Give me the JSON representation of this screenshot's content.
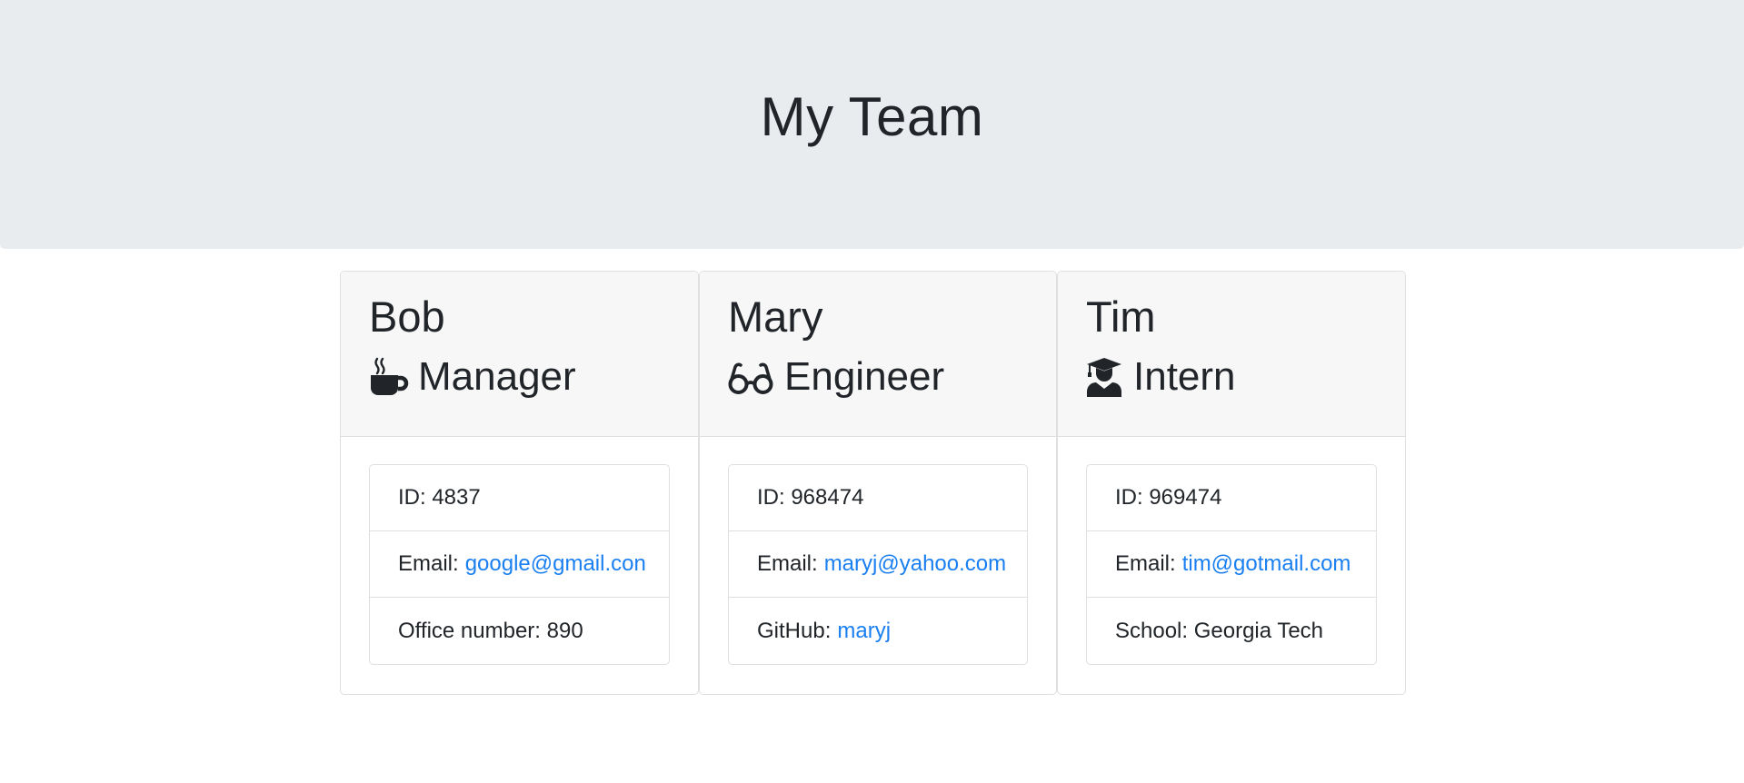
{
  "header": {
    "title": "My Team"
  },
  "team": [
    {
      "name": "Bob",
      "role": "Manager",
      "icon": "coffee-mug-icon",
      "id_label": "ID: 4837",
      "email_prefix": "Email:",
      "email": "google@gmail.con",
      "extra_label": "Office number: 890"
    },
    {
      "name": "Mary",
      "role": "Engineer",
      "icon": "glasses-icon",
      "id_label": "ID: 968474",
      "email_prefix": "Email:",
      "email": "maryj@yahoo.com",
      "extra_prefix": "GitHub:",
      "extra_link": "maryj"
    },
    {
      "name": "Tim",
      "role": "Intern",
      "icon": "graduate-icon",
      "id_label": "ID: 969474",
      "email_prefix": "Email:",
      "email": "tim@gotmail.com",
      "extra_label": "School: Georgia Tech"
    }
  ],
  "colors": {
    "header_bg": "#e9ecef",
    "card_header_bg": "#f7f7f7",
    "link": "#1a7ff0",
    "text": "#212529"
  }
}
